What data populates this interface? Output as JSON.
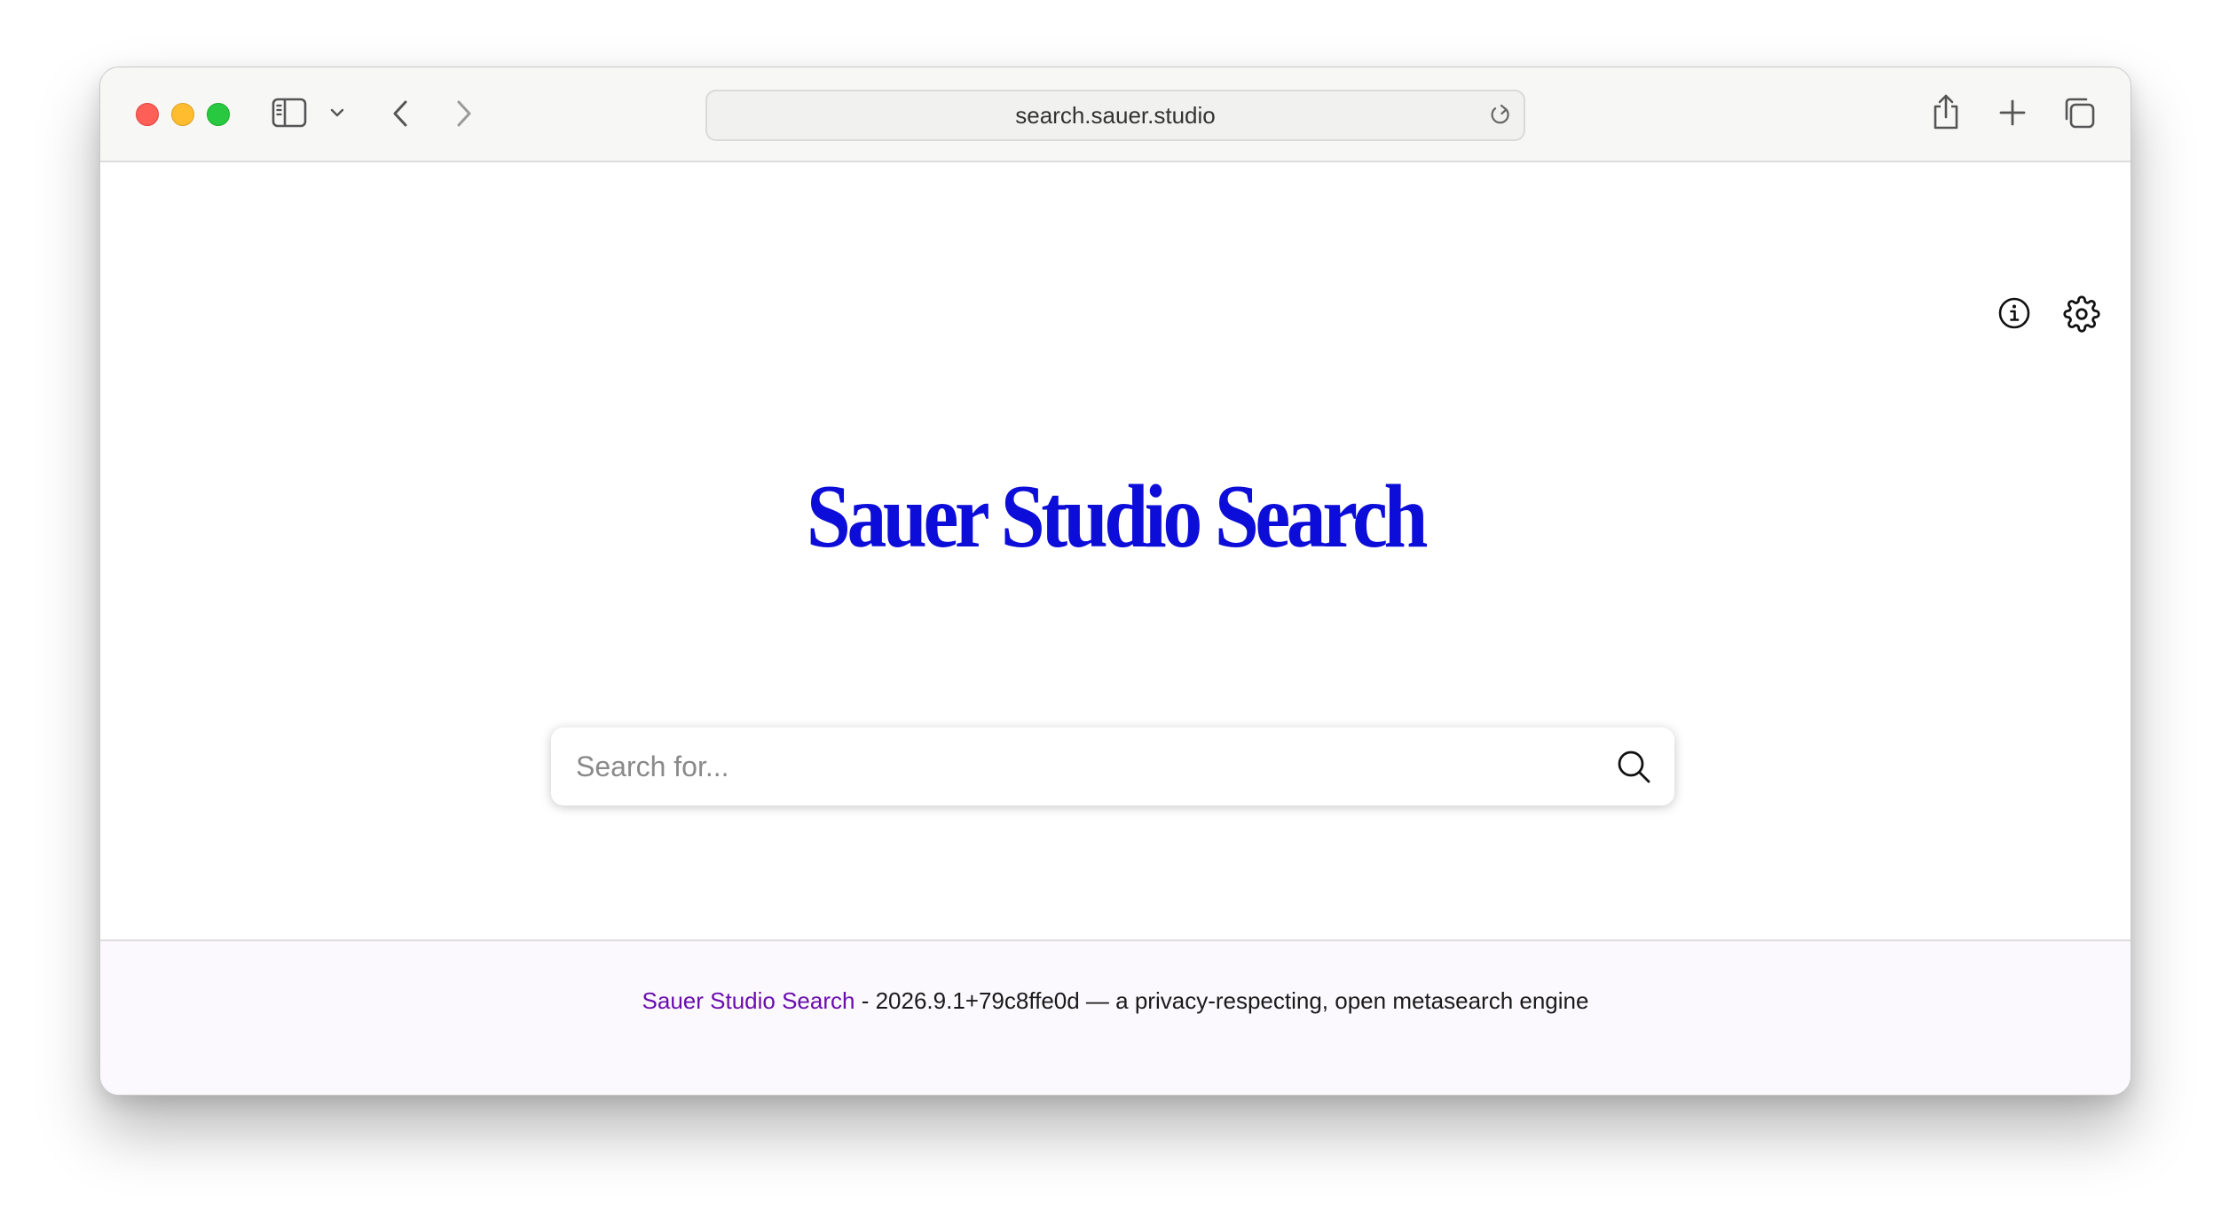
{
  "browser": {
    "url": "search.sauer.studio"
  },
  "header": {
    "info_icon": "info-circle-icon",
    "settings_icon": "gear-icon"
  },
  "main": {
    "title": "Sauer Studio Search",
    "search": {
      "placeholder": "Search for...",
      "value": ""
    }
  },
  "footer": {
    "link_text": "Sauer Studio Search",
    "version_text": " - 2026.9.1+79c8ffe0d — a privacy-respecting, open metasearch engine"
  },
  "colors": {
    "title": "#0d0dd9",
    "footer_link": "#6a0dad",
    "footer_bg": "#fbf9fd"
  }
}
